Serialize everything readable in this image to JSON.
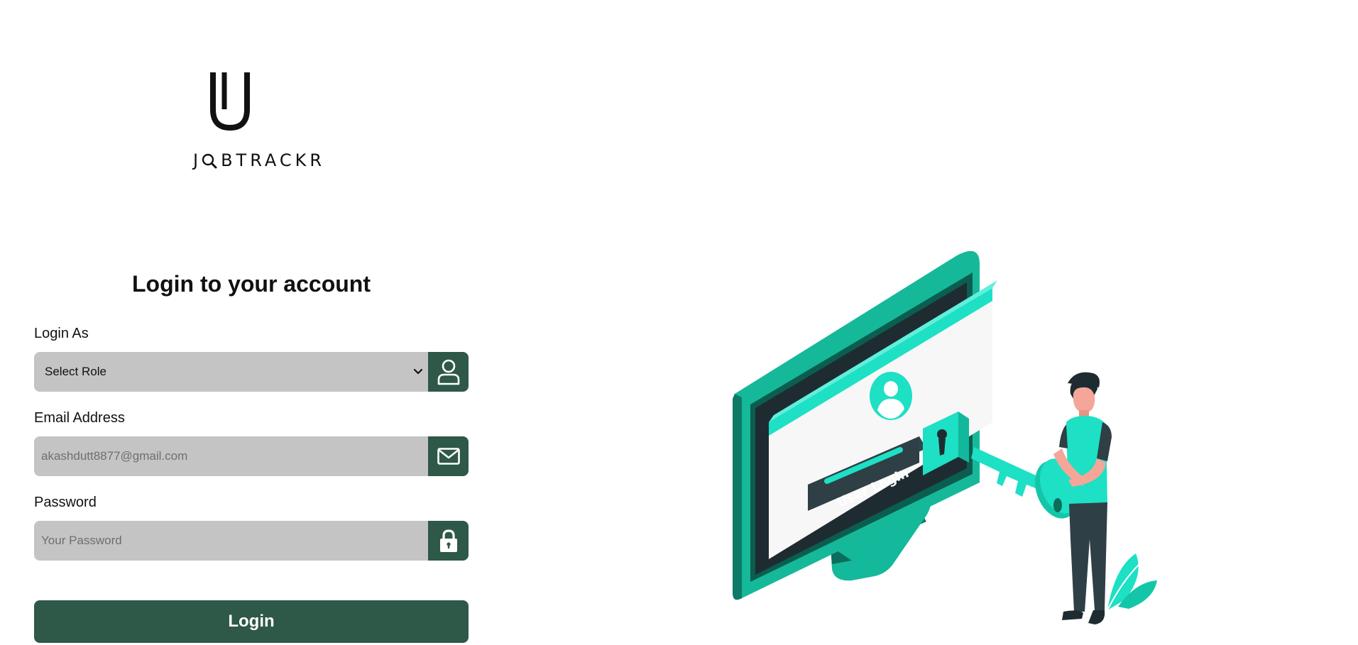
{
  "brand": {
    "name_prefix": "J",
    "name_suffix": "BTRACKR"
  },
  "login_form": {
    "title": "Login to your account",
    "role": {
      "label": "Login As",
      "selected_value": "Select Role",
      "icon": "user-icon"
    },
    "email": {
      "label": "Email Address",
      "placeholder": "akashdutt8877@gmail.com",
      "icon": "mail-icon"
    },
    "password": {
      "label": "Password",
      "placeholder": "Your Password",
      "icon": "lock-icon"
    },
    "submit_label": "Login"
  },
  "illustration": {
    "screen_button_text": "User Login"
  },
  "colors": {
    "primary": "#2e5848",
    "field_bg": "#c4c4c4",
    "accent": "#1de0c5"
  }
}
